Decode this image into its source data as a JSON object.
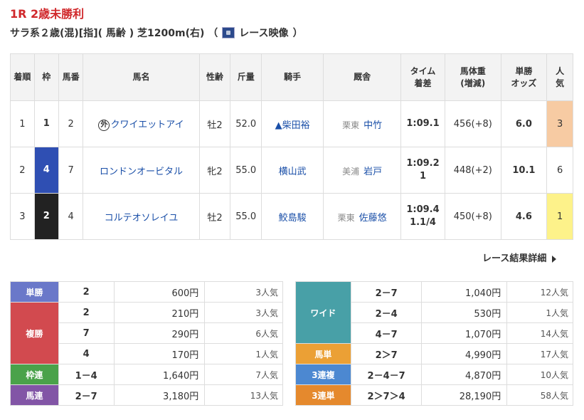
{
  "race": {
    "title": "1R 2歳未勝利",
    "subtitle_text": "サラ系２歳(混)[指]( 馬齢 ) 芝1200m(右) （",
    "video_label": "レース映像",
    "subtitle_close": "）"
  },
  "table": {
    "headers": {
      "chaku": "着順",
      "waku": "枠",
      "uma": "馬番",
      "name": "馬名",
      "sex": "性齢",
      "kin": "斤量",
      "jockey": "騎手",
      "stable": "厩舎",
      "time": "タイム着差",
      "weight": "馬体重(増減)",
      "odds": "単勝オッズ",
      "pop": "人気"
    },
    "rows": [
      {
        "chaku": "1",
        "waku": "1",
        "uma": "2",
        "mark": "外",
        "name": "クワイエットアイ",
        "sex": "牡2",
        "kin": "52.0",
        "jockey": "▲柴田裕",
        "region": "栗東",
        "stable": "中竹",
        "time": "1:09.1",
        "margin": "",
        "weight": "456(+8)",
        "odds": "6.0",
        "pop": "3"
      },
      {
        "chaku": "2",
        "waku": "4",
        "uma": "7",
        "mark": "",
        "name": "ロンドンオービタル",
        "sex": "牝2",
        "kin": "55.0",
        "jockey": "横山武",
        "region": "美浦",
        "stable": "岩戸",
        "time": "1:09.2",
        "margin": "1",
        "weight": "448(+2)",
        "odds": "10.1",
        "pop": "6"
      },
      {
        "chaku": "3",
        "waku": "2",
        "uma": "4",
        "mark": "",
        "name": "コルテオソレイユ",
        "sex": "牡2",
        "kin": "55.0",
        "jockey": "鮫島駿",
        "region": "栗東",
        "stable": "佐藤悠",
        "time": "1:09.4",
        "margin": "1.1/4",
        "weight": "450(+8)",
        "odds": "4.6",
        "pop": "1"
      }
    ]
  },
  "detail_link": "レース結果詳細",
  "payout_left": [
    {
      "label": "単勝",
      "color": "#6a78c9",
      "nums": [
        "2"
      ],
      "amts": [
        "600円"
      ],
      "ninkis": [
        "3人気"
      ]
    },
    {
      "label": "複勝",
      "color": "#d24a4f",
      "nums": [
        "2",
        "7",
        "4"
      ],
      "amts": [
        "210円",
        "290円",
        "170円"
      ],
      "ninkis": [
        "3人気",
        "6人気",
        "1人気"
      ]
    },
    {
      "label": "枠連",
      "color": "#4aa24a",
      "nums": [
        "1－4"
      ],
      "amts": [
        "1,640円"
      ],
      "ninkis": [
        "7人気"
      ]
    },
    {
      "label": "馬連",
      "color": "#8255a6",
      "nums": [
        "2－7"
      ],
      "amts": [
        "3,180円"
      ],
      "ninkis": [
        "13人気"
      ]
    }
  ],
  "payout_right": [
    {
      "label": "ワイド",
      "color": "#48a0a7",
      "nums": [
        "2－7",
        "2－4",
        "4－7"
      ],
      "amts": [
        "1,040円",
        "530円",
        "1,070円"
      ],
      "ninkis": [
        "12人気",
        "1人気",
        "14人気"
      ]
    },
    {
      "label": "馬単",
      "color": "#eba035",
      "nums": [
        "2＞7"
      ],
      "amts": [
        "4,990円"
      ],
      "ninkis": [
        "17人気"
      ]
    },
    {
      "label": "3連複",
      "color": "#4c88d1",
      "nums": [
        "2－4－7"
      ],
      "amts": [
        "4,870円"
      ],
      "ninkis": [
        "10人気"
      ]
    },
    {
      "label": "3連単",
      "color": "#e5892d",
      "nums": [
        "2＞7＞4"
      ],
      "amts": [
        "28,190円"
      ],
      "ninkis": [
        "58人気"
      ]
    }
  ]
}
